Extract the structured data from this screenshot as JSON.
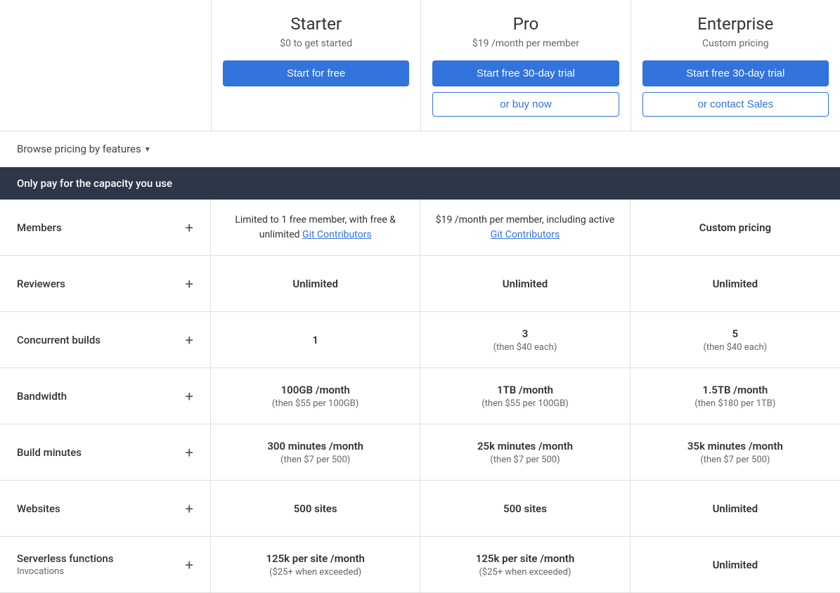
{
  "header": {
    "browse_label": "Browse pricing by features",
    "chevron": "▾"
  },
  "plans": [
    {
      "name": "Starter",
      "price": "$0 to get started",
      "btn1_label": "Start for free",
      "btn1_type": "primary",
      "btn2_label": null
    },
    {
      "name": "Pro",
      "price": "$19 /month per member",
      "btn1_label": "Start free 30-day trial",
      "btn1_type": "primary",
      "btn2_label": "or buy now"
    },
    {
      "name": "Enterprise",
      "price": "Custom pricing",
      "btn1_label": "Start free 30-day trial",
      "btn1_type": "primary",
      "btn2_label": "or contact Sales"
    }
  ],
  "section_title": "Only pay for the capacity you use",
  "features": [
    {
      "label": "Members",
      "sublabel": null,
      "values": [
        {
          "main": "Limited to 1 free member, with free & unlimited ",
          "link": "Git Contributors",
          "sub": null
        },
        {
          "main": "$19 /month per member, including active ",
          "link": "Git Contributors",
          "sub": null
        },
        {
          "main": "Custom pricing",
          "link": null,
          "sub": null
        }
      ]
    },
    {
      "label": "Reviewers",
      "sublabel": null,
      "values": [
        {
          "main": "Unlimited",
          "link": null,
          "sub": null
        },
        {
          "main": "Unlimited",
          "link": null,
          "sub": null
        },
        {
          "main": "Unlimited",
          "link": null,
          "sub": null
        }
      ]
    },
    {
      "label": "Concurrent builds",
      "sublabel": null,
      "values": [
        {
          "main": "1",
          "link": null,
          "sub": null
        },
        {
          "main": "3",
          "link": null,
          "sub": "(then $40 each)"
        },
        {
          "main": "5",
          "link": null,
          "sub": "(then $40 each)"
        }
      ]
    },
    {
      "label": "Bandwidth",
      "sublabel": null,
      "values": [
        {
          "main": "100GB /month",
          "link": null,
          "sub": "(then $55 per 100GB)"
        },
        {
          "main": "1TB /month",
          "link": null,
          "sub": "(then $55 per 100GB)"
        },
        {
          "main": "1.5TB /month",
          "link": null,
          "sub": "(then $180 per 1TB)"
        }
      ]
    },
    {
      "label": "Build minutes",
      "sublabel": null,
      "values": [
        {
          "main": "300 minutes /month",
          "link": null,
          "sub": "(then $7 per 500)"
        },
        {
          "main": "25k minutes /month",
          "link": null,
          "sub": "(then $7 per 500)"
        },
        {
          "main": "35k minutes /month",
          "link": null,
          "sub": "(then $7 per 500)"
        }
      ]
    },
    {
      "label": "Websites",
      "sublabel": null,
      "values": [
        {
          "main": "500 sites",
          "link": null,
          "sub": null
        },
        {
          "main": "500 sites",
          "link": null,
          "sub": null
        },
        {
          "main": "Unlimited",
          "link": null,
          "sub": null
        }
      ]
    },
    {
      "label": "Serverless functions",
      "sublabel": "Invocations",
      "values": [
        {
          "main": "125k per site /month",
          "link": null,
          "sub": "($25+ when exceeded)"
        },
        {
          "main": "125k per site /month",
          "link": null,
          "sub": "($25+ when exceeded)"
        },
        {
          "main": "Unlimited",
          "link": null,
          "sub": null
        }
      ]
    }
  ]
}
